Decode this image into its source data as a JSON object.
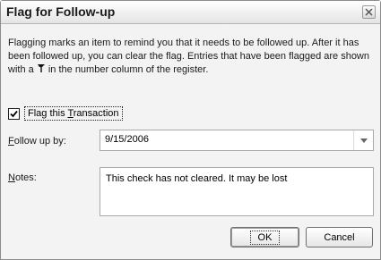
{
  "dialog": {
    "title": "Flag for Follow-up",
    "description_before": "Flagging marks an item to remind you that it needs to be followed up. After it has been followed up, you can clear the flag. Entries that have been flagged are shown with a ",
    "description_after": " in the number column of the register.",
    "inline_icon": "flag-icon"
  },
  "flag_checkbox": {
    "label_before": "Flag this ",
    "label_mnemonic": "T",
    "label_after": "ransaction",
    "checked": true
  },
  "follow_up": {
    "label_mnemonic": "F",
    "label_after": "ollow up by:",
    "value": "9/15/2006"
  },
  "notes": {
    "label_mnemonic": "N",
    "label_after": "otes:",
    "value": "This check has not cleared. It may be lost"
  },
  "buttons": {
    "ok": "OK",
    "cancel": "Cancel"
  }
}
